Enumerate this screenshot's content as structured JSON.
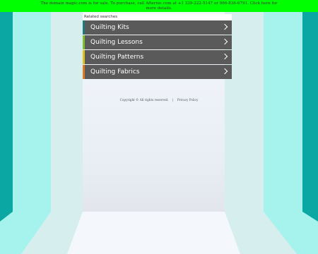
{
  "banner": {
    "text": "The domain magic.com is for sale. To purchase, call Afternic.com at +1 339-222-5147 or 866-836-6791. Click here for more details."
  },
  "related": {
    "title": "Related searches",
    "links": [
      {
        "label": "Quilting Kits",
        "accent": "#1e7b7b"
      },
      {
        "label": "Quilting Lessons",
        "accent": "#7fbf2f"
      },
      {
        "label": "Quilting Patterns",
        "accent": "#e0c020"
      },
      {
        "label": "Quilting Fabrics",
        "accent": "#e07a20"
      }
    ]
  },
  "footer": {
    "copyright": "Copyright ©  All rights reserved.",
    "separator": "|",
    "privacy": "Privacy Policy"
  },
  "colors": {
    "banner_bg": "#00ff00",
    "teal_dark": "#0aa4a0",
    "teal_light": "#a6f3ee",
    "panel_light": "#d9efef",
    "stage": "#f2f6fc"
  }
}
